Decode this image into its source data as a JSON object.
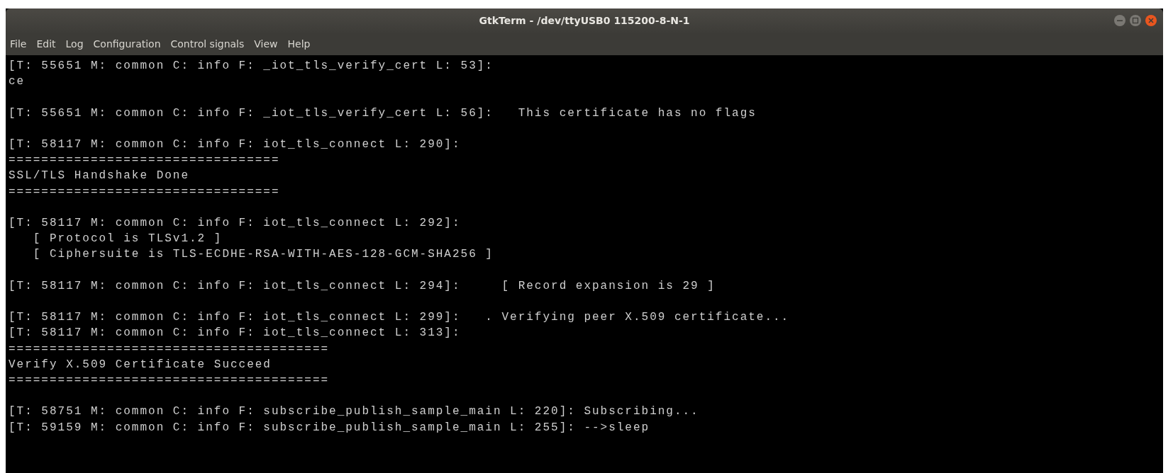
{
  "window": {
    "title": "GtkTerm - /dev/ttyUSB0  115200-8-N-1"
  },
  "menu": [
    "File",
    "Edit",
    "Log",
    "Configuration",
    "Control signals",
    "View",
    "Help"
  ],
  "terminal": {
    "blocks": [
      [
        "[T: 55651 M: common C: info F: _iot_tls_verify_cert L: 53]:",
        "ce"
      ],
      [
        "[T: 55651 M: common C: info F: _iot_tls_verify_cert L: 56]:   This certificate has no flags"
      ],
      [
        "[T: 58117 M: common C: info F: iot_tls_connect L: 290]:",
        "=================================",
        "SSL/TLS Handshake Done",
        "================================="
      ],
      [
        "[T: 58117 M: common C: info F: iot_tls_connect L: 292]:",
        "   [ Protocol is TLSv1.2 ]",
        "   [ Ciphersuite is TLS-ECDHE-RSA-WITH-AES-128-GCM-SHA256 ]"
      ],
      [
        "[T: 58117 M: common C: info F: iot_tls_connect L: 294]:     [ Record expansion is 29 ]"
      ],
      [
        "[T: 58117 M: common C: info F: iot_tls_connect L: 299]:   . Verifying peer X.509 certificate...",
        "[T: 58117 M: common C: info F: iot_tls_connect L: 313]:",
        "=======================================",
        "Verify X.509 Certificate Succeed",
        "======================================="
      ],
      [
        "[T: 58751 M: common C: info F: subscribe_publish_sample_main L: 220]: Subscribing...",
        "[T: 59159 M: common C: info F: subscribe_publish_sample_main L: 255]: -->sleep"
      ]
    ]
  }
}
